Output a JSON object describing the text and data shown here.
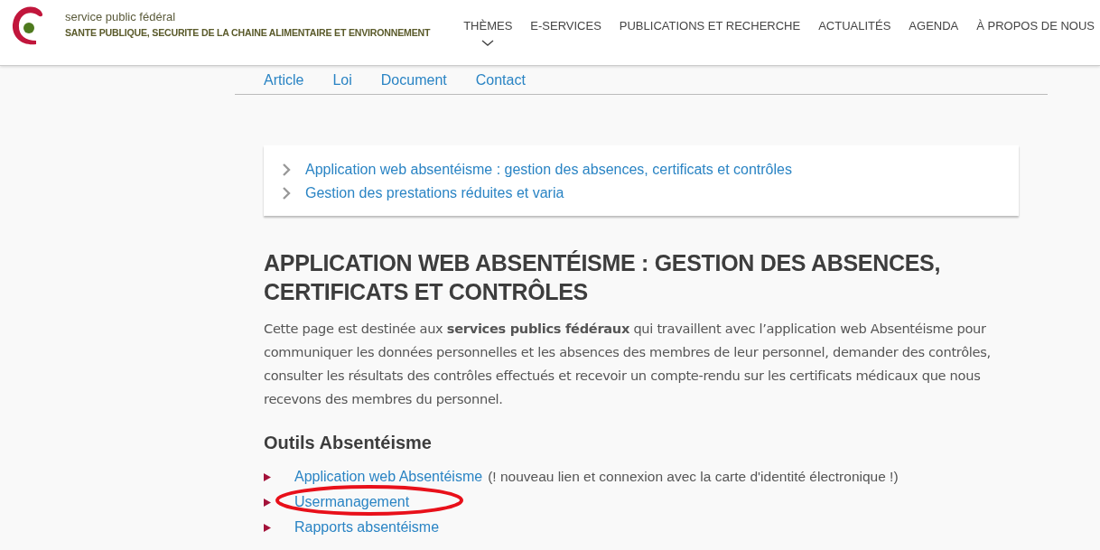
{
  "header": {
    "org_line": "service public fédéral",
    "org_name": "SANTE PUBLIQUE, SECURITE DE LA CHAINE ALIMENTAIRE  ET ENVIRONNEMENT",
    "nav": [
      {
        "label": "THÈMES",
        "selected": true
      },
      {
        "label": "E-SERVICES",
        "selected": false
      },
      {
        "label": "PUBLICATIONS ET RECHERCHE",
        "selected": false
      },
      {
        "label": "ACTUALITÉS",
        "selected": false
      },
      {
        "label": "AGENDA",
        "selected": false
      },
      {
        "label": "À PROPOS DE NOUS",
        "selected": false
      }
    ]
  },
  "filter_tabs": [
    "Article",
    "Loi",
    "Document",
    "Contact"
  ],
  "toc": [
    "Application web absentéisme : gestion des absences, certificats et contrôles",
    "Gestion des prestations réduites et varia"
  ],
  "title": "APPLICATION WEB ABSENTÉISME : GESTION DES ABSENCES, CERTIFICATS ET CONTRÔLES",
  "intro": "Cette page est destinée aux **services publics fédéraux** qui travaillent avec l’application web Absentéisme pour communiquer les données personnelles et les absences des membres de leur personnel, demander des contrôles, consulter les résultats des contrôles effectués et recevoir un compte-rendu sur les certificats médicaux que nous recevons des membres du personnel.",
  "section_title": "Outils Absentéisme",
  "tools": [
    {
      "link": "Application web Absentéisme",
      "note": "(! nouveau lien et connexion avec la carte d'identité électronique !)",
      "circled": false
    },
    {
      "link": "Usermanagement",
      "circled": true
    },
    {
      "link": "Rapports absentéisme",
      "circled": false
    }
  ]
}
